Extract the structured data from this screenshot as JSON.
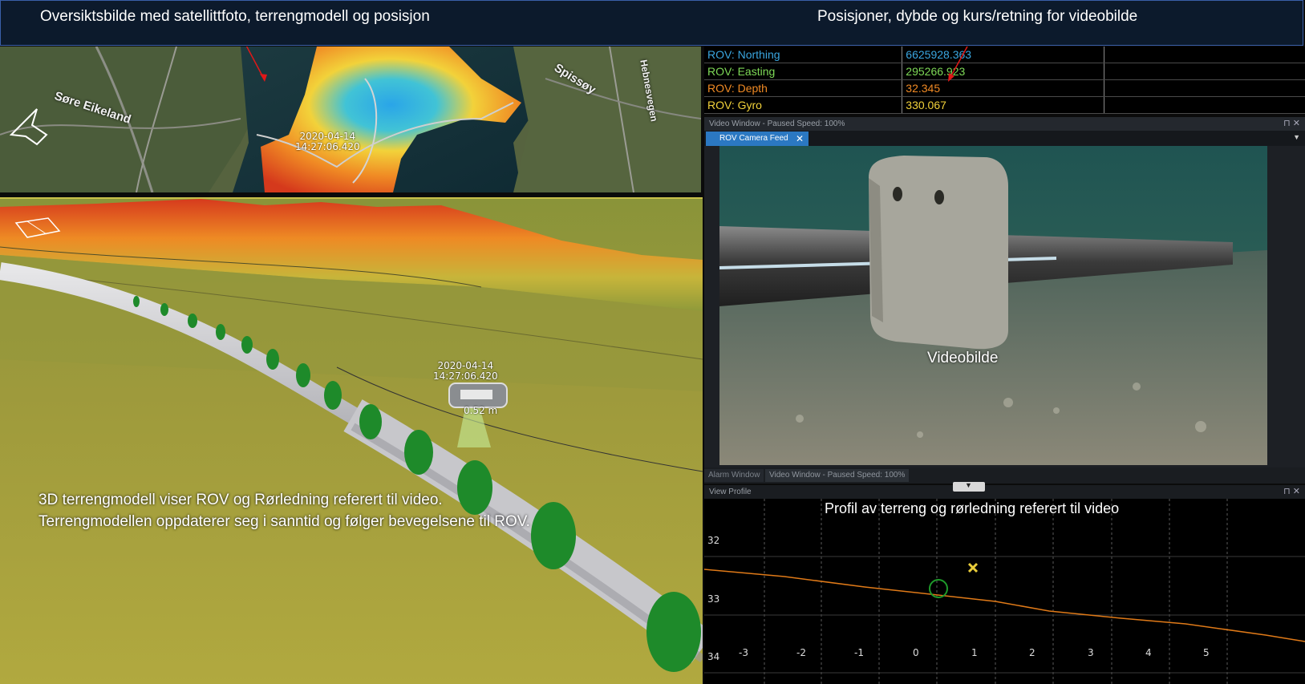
{
  "header": {
    "left_caption": "Oversiktsbilde med satellittfoto, terrengmodell og posisjon",
    "right_caption": "Posisjoner, dybde og kurs/retning for videobilde"
  },
  "map": {
    "place_labels": [
      "Søre Eikeland",
      "Spissøy",
      "Hebnesvegen"
    ],
    "rov_timestamp_date": "2020-04-14",
    "rov_timestamp_time": "14:27:06.420",
    "compass_icon": "north-arrow-icon"
  },
  "view3d": {
    "rov_timestamp_date": "2020-04-14",
    "rov_timestamp_time": "14:27:06.420",
    "altitude_label": "0.52 m",
    "caption_line1": "3D terrengmodell viser ROV og Rørledning referert til video.",
    "caption_line2": "Terrengmodellen oppdaterer seg i sanntid og følger bevegelsene til ROV."
  },
  "table": {
    "rows": [
      {
        "label": "ROV: Northing",
        "value": "6625928.363",
        "color": "#3aa6e0"
      },
      {
        "label": "ROV: Easting",
        "value": "295266.923",
        "color": "#7ed957"
      },
      {
        "label": "ROV: Depth",
        "value": "32.345",
        "color": "#f08a24"
      },
      {
        "label": "ROV: Gyro",
        "value": "330.067",
        "color": "#f2d23a"
      }
    ]
  },
  "video_window": {
    "title": "Video Window - Paused Speed: 100%",
    "tab_label": "ROV Camera Feed",
    "tab_close": "✕",
    "overlay_label": "Videobilde",
    "bottom_tabs": [
      "Alarm Window",
      "Video Window - Paused Speed: 100%"
    ],
    "pin_icon": "pin-icon",
    "close_icon": "close-icon"
  },
  "profile": {
    "title": "View Profile",
    "caption": "Profil av terreng og rørledning referert til video",
    "y_ticks": [
      "32",
      "33",
      "34"
    ],
    "x_ticks": [
      "-3",
      "-2",
      "-1",
      "0",
      "1",
      "2",
      "3",
      "4",
      "5"
    ]
  }
}
